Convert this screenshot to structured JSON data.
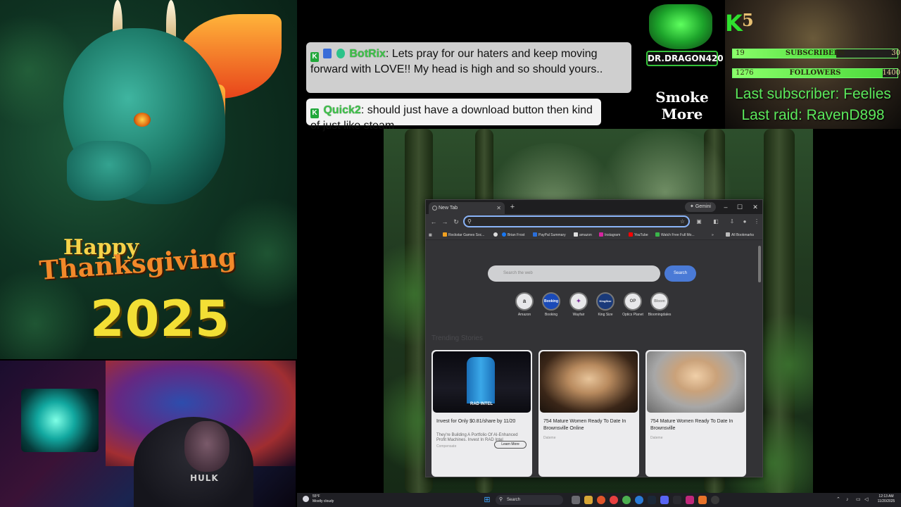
{
  "art": {
    "happy": "Happy",
    "thanksgiving": "Thanksgiving",
    "year": "2025"
  },
  "webcam": {
    "shirt_text": "HULK"
  },
  "chat": {
    "messages": [
      {
        "username": "BotRix",
        "text": ": Lets pray for our haters and keep moving forward with LOVE!! My head is high and so should yours..",
        "badges": [
          "k-badge-icon",
          "bot-badge-icon",
          "verified-badge-icon"
        ]
      },
      {
        "username": "Quick2",
        "text": ": should just have a download button then kind of just like steam",
        "badges": [
          "k-badge-icon"
        ]
      }
    ]
  },
  "logo": {
    "name": "DR.DRAGON420",
    "tagline": "Smoke More"
  },
  "stats": {
    "k_letter": "K",
    "number": "5",
    "subscribers": {
      "label": "SUBSCRIBERS",
      "current": "19",
      "goal": "30",
      "progress": 0.63
    },
    "followers": {
      "label": "FOLLOWERS",
      "current": "1276",
      "goal": "1400",
      "progress": 0.91
    },
    "last_subscriber": "Last subscriber: Feelies",
    "last_raid": "Last raid: RavenD898"
  },
  "browser": {
    "tab_title": "New Tab",
    "gemini_label": "Gemini",
    "bookmarks": [
      {
        "label": "Rockstar Games Soc...",
        "color": "#f0a020"
      },
      {
        "label": "",
        "color": "#dddddd"
      },
      {
        "label": "Brian Frost",
        "color": "#1877f2"
      },
      {
        "label": "PayPal Summary",
        "color": "#2a6fdb"
      },
      {
        "label": "amazon",
        "color": "#dddddd"
      },
      {
        "label": "Instagram",
        "color": "#d6249f"
      },
      {
        "label": "YouTube",
        "color": "#ff0000"
      },
      {
        "label": "Watch Free Full Mo...",
        "color": "#3ab54a"
      }
    ],
    "all_bookmarks": "All Bookmarks",
    "search_placeholder": "Search the web",
    "search_button": "Search",
    "shortcuts": [
      {
        "label": "Amazon",
        "glyph": "a",
        "icon": "amazon-icon"
      },
      {
        "label": "Booking",
        "glyph": "Booking",
        "icon": "booking-icon"
      },
      {
        "label": "Wayfair",
        "glyph": "✦",
        "icon": "wayfair-icon"
      },
      {
        "label": "King Size",
        "glyph": "KingSize",
        "icon": "kingsize-icon"
      },
      {
        "label": "Optics Planet",
        "glyph": "OP",
        "icon": "opticsplanet-icon"
      },
      {
        "label": "Bloomingdales",
        "glyph": "Bloom",
        "icon": "bloomingdales-icon"
      }
    ],
    "trending_title": "Trending Stories",
    "cards": [
      {
        "title": "Invest for Only $0.81/share by 11/20",
        "desc": "They're Building A Portfolio Of AI-Enhanced Profit Machines. Invest In RAD Intel",
        "source": "Compensate",
        "cta": "Learn More",
        "image_label": "RAD INTEL"
      },
      {
        "title": "754 Mature Women Ready To Date In Brownsville Online",
        "desc": "",
        "source": "Dateme",
        "cta": "",
        "image_label": ""
      },
      {
        "title": "754 Mature Women Ready To Date In Brownsville",
        "desc": "",
        "source": "Dateme",
        "cta": "",
        "image_label": ""
      }
    ]
  },
  "taskbar": {
    "temperature": "55°F",
    "condition": "Mostly cloudy",
    "search_label": "Search",
    "time": "12:13 AM",
    "date": "11/20/2025"
  }
}
